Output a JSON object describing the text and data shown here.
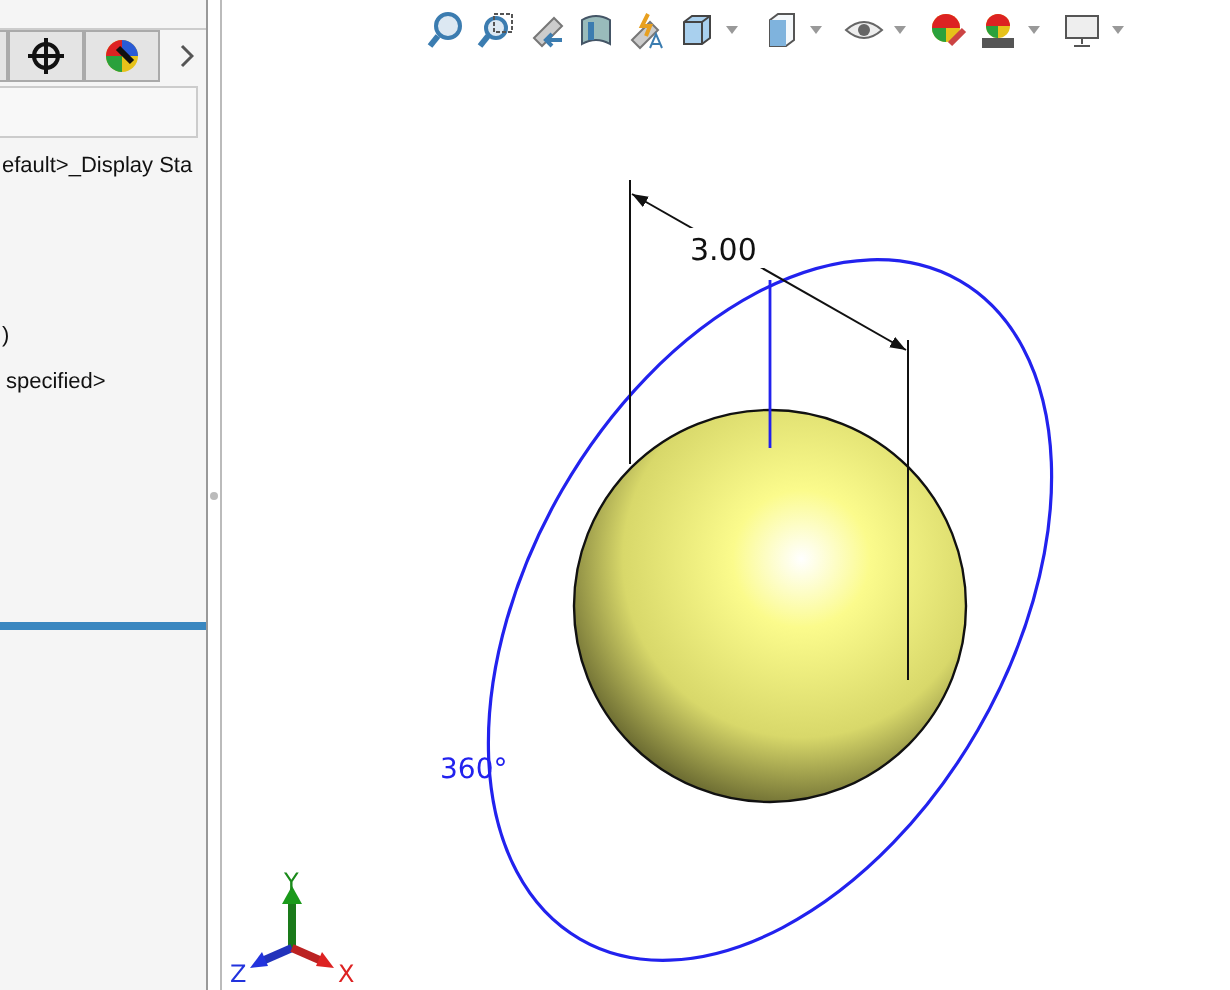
{
  "panel": {
    "tabs": [
      {
        "selected": false
      },
      {
        "selected": false
      }
    ],
    "lines": [
      {
        "text": "efault>_Display Sta"
      },
      {
        "text": ")"
      },
      {
        "text": "specified>"
      }
    ]
  },
  "viewport": {
    "dimension": "3.00",
    "angle": "360°",
    "triad": {
      "x": "X",
      "y": "Y",
      "z": "Z"
    }
  }
}
